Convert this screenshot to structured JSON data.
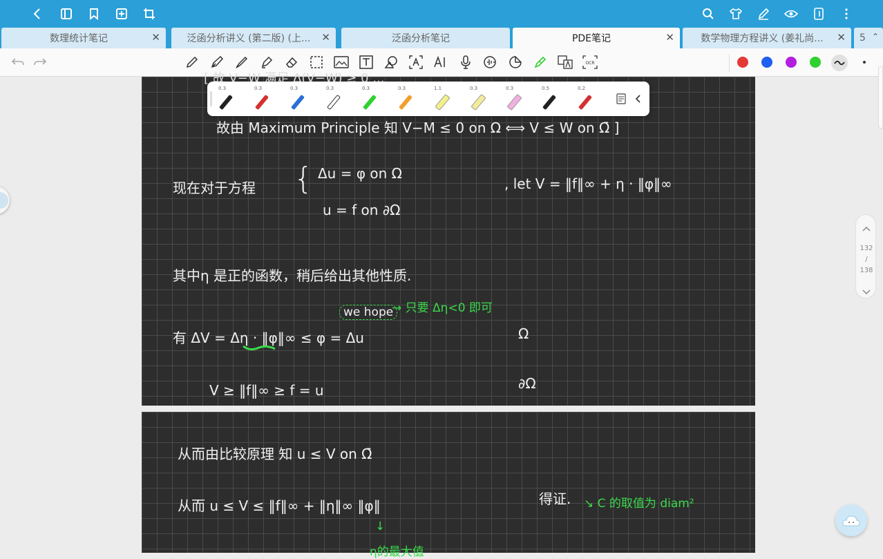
{
  "topbar": {
    "icons": [
      "back-icon",
      "book-icon",
      "bookmark-icon",
      "add-page-icon",
      "crop-icon",
      "search-icon",
      "shirt-icon",
      "pen-edit-icon",
      "eye-icon",
      "tablet-icon",
      "more-icon"
    ]
  },
  "tabs": [
    {
      "title": "数理统计笔记",
      "active": false
    },
    {
      "title": "泛函分析讲义 (第二版) (上...",
      "active": false
    },
    {
      "title": "泛函分析笔记",
      "active": false
    },
    {
      "title": "PDE笔记",
      "active": true
    },
    {
      "title": "数学物理方程讲义 (姜礼尚...",
      "active": false
    },
    {
      "title": "5",
      "active": false
    }
  ],
  "palette": {
    "colors": [
      "#e53935",
      "#1e5ef0",
      "#b31ee0",
      "#2ed12e"
    ]
  },
  "pens": [
    {
      "size": "0.3",
      "color": "#222222"
    },
    {
      "size": "0.3",
      "color": "#d43030"
    },
    {
      "size": "0.3",
      "color": "#2b6fd6"
    },
    {
      "size": "0.3",
      "color": "#ffffff"
    },
    {
      "size": "0.3",
      "color": "#2ed12e"
    },
    {
      "size": "0.3",
      "color": "#f0a030"
    },
    {
      "size": "1.1",
      "color": "#f3f08a"
    },
    {
      "size": "0.3",
      "color": "#f5ec9a"
    },
    {
      "size": "0.3",
      "color": "#f0b0e0"
    },
    {
      "size": "0.5",
      "color": "#222222"
    },
    {
      "size": "0.2",
      "color": "#d43030"
    }
  ],
  "pager": {
    "current": "132",
    "sep": "/",
    "total": "138"
  },
  "page1": {
    "line1": "故由 Maximum Principle 知  V−M ≤ 0    on  Ω   ⟺   V ≤ W    on  Ω̄ ]",
    "eq_prefix": "现在对于方程",
    "eq_top": "Δu = φ           on   Ω",
    "eq_bottom": "u = f             on    ∂Ω",
    "let": ",   let   V = ‖f‖∞ + η · ‖φ‖∞",
    "eta_desc": "其中η 是正的函数，稍后给出其他性质.",
    "we_hope": "we hope",
    "hope_note": "→ 只要 Δη<0 即可",
    "delta_v": "有 ΔV =  Δη · ‖φ‖∞     ≤       φ  = Δu",
    "omega1": "Ω",
    "v_ge": "V ≥  ‖f‖∞   ≥ f = u",
    "omega2": "∂Ω"
  },
  "page2": {
    "line1": "从而由比较原理   知    u ≤ V     on    Ω̄",
    "line2": "从而    u ≤ V  ≤  ‖f‖∞  +  ‖η‖∞ ‖φ‖",
    "proved": "得证.",
    "c_note": "↘  C 的取值为 diam²",
    "arrow": "↓",
    "eta_max": "η的最大值"
  }
}
